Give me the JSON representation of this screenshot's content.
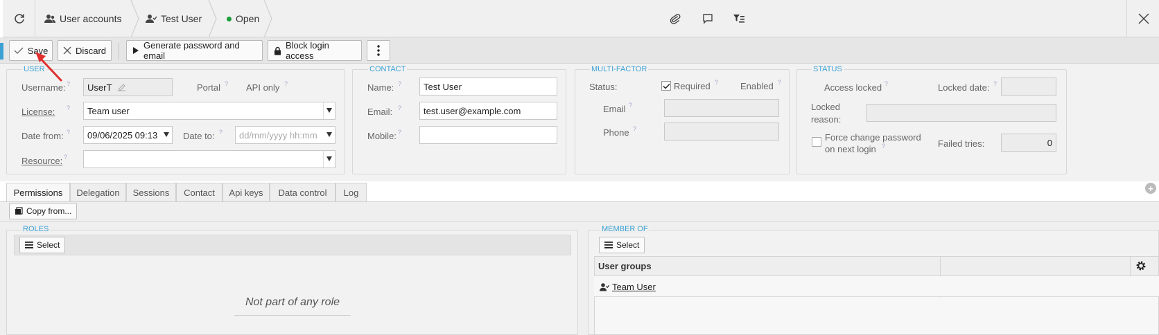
{
  "breadcrumb": {
    "refresh_icon": "refresh-icon",
    "items": [
      {
        "label": "User accounts",
        "icon": "users-icon"
      },
      {
        "label": "Test User",
        "icon": "user-icon"
      },
      {
        "label": "Open",
        "icon": "status-dot-green"
      }
    ],
    "status_color": "#1a9e3a"
  },
  "header_icons": [
    "paperclip-icon",
    "comment-icon",
    "filter-list-icon",
    "close-icon"
  ],
  "toolbar": {
    "save_label": "Save",
    "discard_label": "Discard",
    "generate_label": "Generate password and email",
    "block_label": "Block login access",
    "more_icon": "more-vertical-icon"
  },
  "user": {
    "title": "USER",
    "username_label": "Username:",
    "username_value": "UserT",
    "portal_label": "Portal",
    "api_only_label": "API only",
    "license_label": "License:",
    "license_value": "Team user",
    "date_from_label": "Date from:",
    "date_from_value": "09/06/2025 09:13",
    "date_to_label": "Date to:",
    "date_to_placeholder": "dd/mm/yyyy hh:mm",
    "resource_label": "Resource:",
    "resource_value": ""
  },
  "contact": {
    "title": "CONTACT",
    "name_label": "Name:",
    "name_value": "Test User",
    "email_label": "Email:",
    "email_value": "test.user@example.com",
    "mobile_label": "Mobile:",
    "mobile_value": ""
  },
  "mfa": {
    "title": "MULTI-FACTOR",
    "status_label": "Status:",
    "required_label": "Required",
    "required_checked": true,
    "enabled_label": "Enabled",
    "email_label": "Email",
    "phone_label": "Phone"
  },
  "status": {
    "title": "STATUS",
    "access_locked_label": "Access locked",
    "locked_date_label": "Locked date:",
    "locked_reason_label_1": "Locked",
    "locked_reason_label_2": "reason:",
    "force_change_label_1": "Force change password",
    "force_change_label_2": "on next login",
    "failed_tries_label": "Failed tries:",
    "failed_tries_value": "0"
  },
  "tabs": [
    {
      "label": "Permissions",
      "active": true
    },
    {
      "label": "Delegation",
      "active": false
    },
    {
      "label": "Sessions",
      "active": false
    },
    {
      "label": "Contact",
      "active": false
    },
    {
      "label": "Api keys",
      "active": false
    },
    {
      "label": "Data control",
      "active": false
    },
    {
      "label": "Log",
      "active": false
    }
  ],
  "permissions": {
    "copy_from_label": "Copy from...",
    "roles": {
      "title": "ROLES",
      "select_label": "Select",
      "empty_text": "Not part of any role"
    },
    "member_of": {
      "title": "MEMBER OF",
      "select_label": "Select",
      "column_header": "User groups",
      "rows": [
        {
          "label": "Team User"
        }
      ]
    }
  },
  "colors": {
    "accent_blue": "#3aa0d4",
    "arrow_red": "#e03030"
  }
}
